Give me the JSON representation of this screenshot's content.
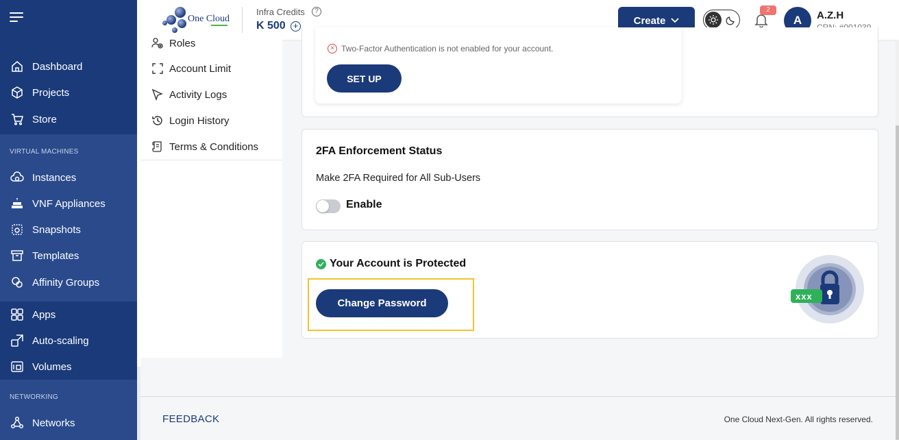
{
  "colors": {
    "brand": "#1b3a7a",
    "success": "#2fb15a",
    "danger": "#e24545",
    "highlight": "#f2c230"
  },
  "sidebar": {
    "items_top": [
      {
        "label": "Dashboard",
        "icon": "home-icon"
      },
      {
        "label": "Projects",
        "icon": "cube-icon"
      },
      {
        "label": "Store",
        "icon": "cart-icon"
      }
    ],
    "sections": {
      "virtual_machines": "VIRTUAL MACHINES",
      "networking": "NETWORKING"
    },
    "vm_items": [
      {
        "label": "Instances",
        "icon": "cloud-icon"
      },
      {
        "label": "VNF Appliances",
        "icon": "firewall-icon"
      },
      {
        "label": "Snapshots",
        "icon": "snapshot-icon"
      },
      {
        "label": "Templates",
        "icon": "template-icon"
      },
      {
        "label": "Affinity Groups",
        "icon": "affinity-icon"
      }
    ],
    "app_items": [
      {
        "label": "Apps",
        "icon": "apps-grid-icon"
      },
      {
        "label": "Auto-scaling",
        "icon": "autoscale-icon"
      },
      {
        "label": "Volumes",
        "icon": "volume-icon"
      }
    ],
    "network_items": [
      {
        "label": "Networks",
        "icon": "network-icon"
      }
    ]
  },
  "header": {
    "logo_text": "One Cloud",
    "credits_label": "Infra Credits",
    "credits_value": "K 500",
    "create_label": "Create",
    "notification_count": "2",
    "avatar_initial": "A",
    "user_name": "A.Z.H",
    "user_crn": "CRN: #001039"
  },
  "submenu": {
    "items": [
      {
        "label": "Roles",
        "icon": "roles-icon"
      },
      {
        "label": "Account Limit",
        "icon": "account-limit-icon"
      },
      {
        "label": "Activity Logs",
        "icon": "cursor-icon"
      },
      {
        "label": "Login History",
        "icon": "history-icon"
      },
      {
        "label": "Terms & Conditions",
        "icon": "scroll-icon"
      }
    ]
  },
  "twofa": {
    "warning": "Two-Factor Authentication is not enabled for your account.",
    "setup_label": "SET UP"
  },
  "enforcement": {
    "title": "2FA Enforcement Status",
    "description": "Make 2FA Required for All Sub-Users",
    "toggle_label": "Enable",
    "enabled": false
  },
  "protection": {
    "status": "Your Account is Protected",
    "change_password_label": "Change Password",
    "password_mask": "xxx"
  },
  "footer": {
    "feedback_label": "FEEDBACK",
    "copyright": "One Cloud Next-Gen. All rights reserved."
  }
}
